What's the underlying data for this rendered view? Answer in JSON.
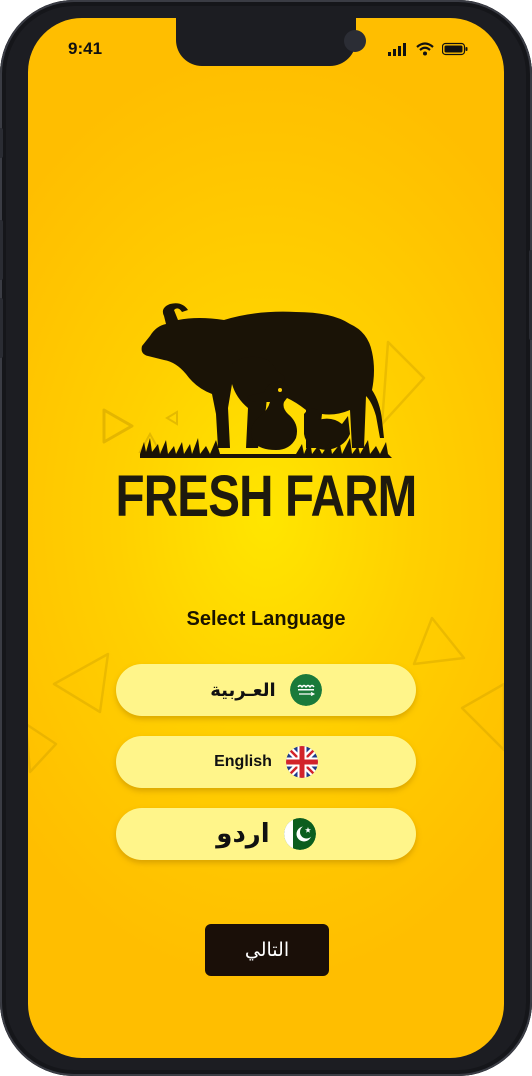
{
  "status_bar": {
    "time": "9:41"
  },
  "brand": {
    "name": "FRESH FARM"
  },
  "language": {
    "title": "Select Language",
    "options": [
      {
        "label": "العـربية",
        "flag": "saudi-arabia-flag-icon"
      },
      {
        "label": "English",
        "flag": "uk-flag-icon"
      },
      {
        "label": "اردو",
        "flag": "pakistan-flag-icon"
      }
    ]
  },
  "actions": {
    "next_label": "التالي"
  },
  "colors": {
    "background": "#ffc400",
    "button": "#fff58a",
    "primary": "#1a0f08"
  }
}
